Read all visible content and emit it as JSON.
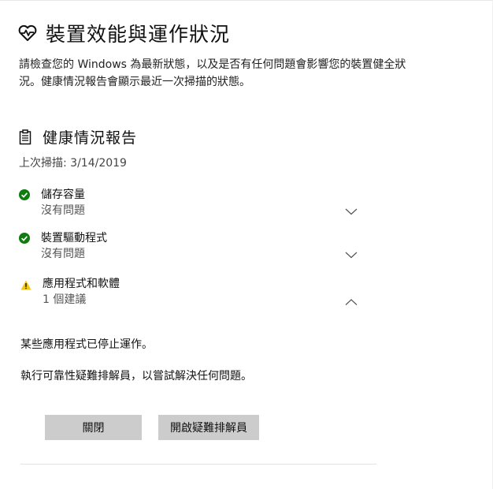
{
  "page": {
    "title": "裝置效能與運作狀況",
    "description": "請檢查您的 Windows 為最新狀態，以及是否有任何問題會影響您的裝置健全狀況。健康情況報告會顯示最近一次掃描的狀態。"
  },
  "report": {
    "title": "健康情況報告",
    "last_scan": "上次掃描: 3/14/2019",
    "items": [
      {
        "title": "儲存容量",
        "status": "沒有問題",
        "state": "ok",
        "expanded": false
      },
      {
        "title": "裝置驅動程式",
        "status": "沒有問題",
        "state": "ok",
        "expanded": false
      },
      {
        "title": "應用程式和軟體",
        "status": "1 個建議",
        "state": "warning",
        "expanded": true
      }
    ],
    "detail": {
      "line1": "某些應用程式已停止運作。",
      "line2": "執行可靠性疑難排解員，以嘗試解決任何問題。"
    },
    "buttons": {
      "close": "關閉",
      "open_troubleshooter": "開啟疑難排解員"
    }
  },
  "colors": {
    "ok": "#107c10",
    "warning": "#f2c811",
    "button_bg": "#cccccc"
  },
  "icons": {
    "page": "heart-pulse-icon",
    "report": "clipboard-icon",
    "ok": "checkmark-circle-icon",
    "warning": "warning-triangle-icon",
    "collapsed": "chevron-down-icon",
    "expanded": "chevron-up-icon"
  }
}
